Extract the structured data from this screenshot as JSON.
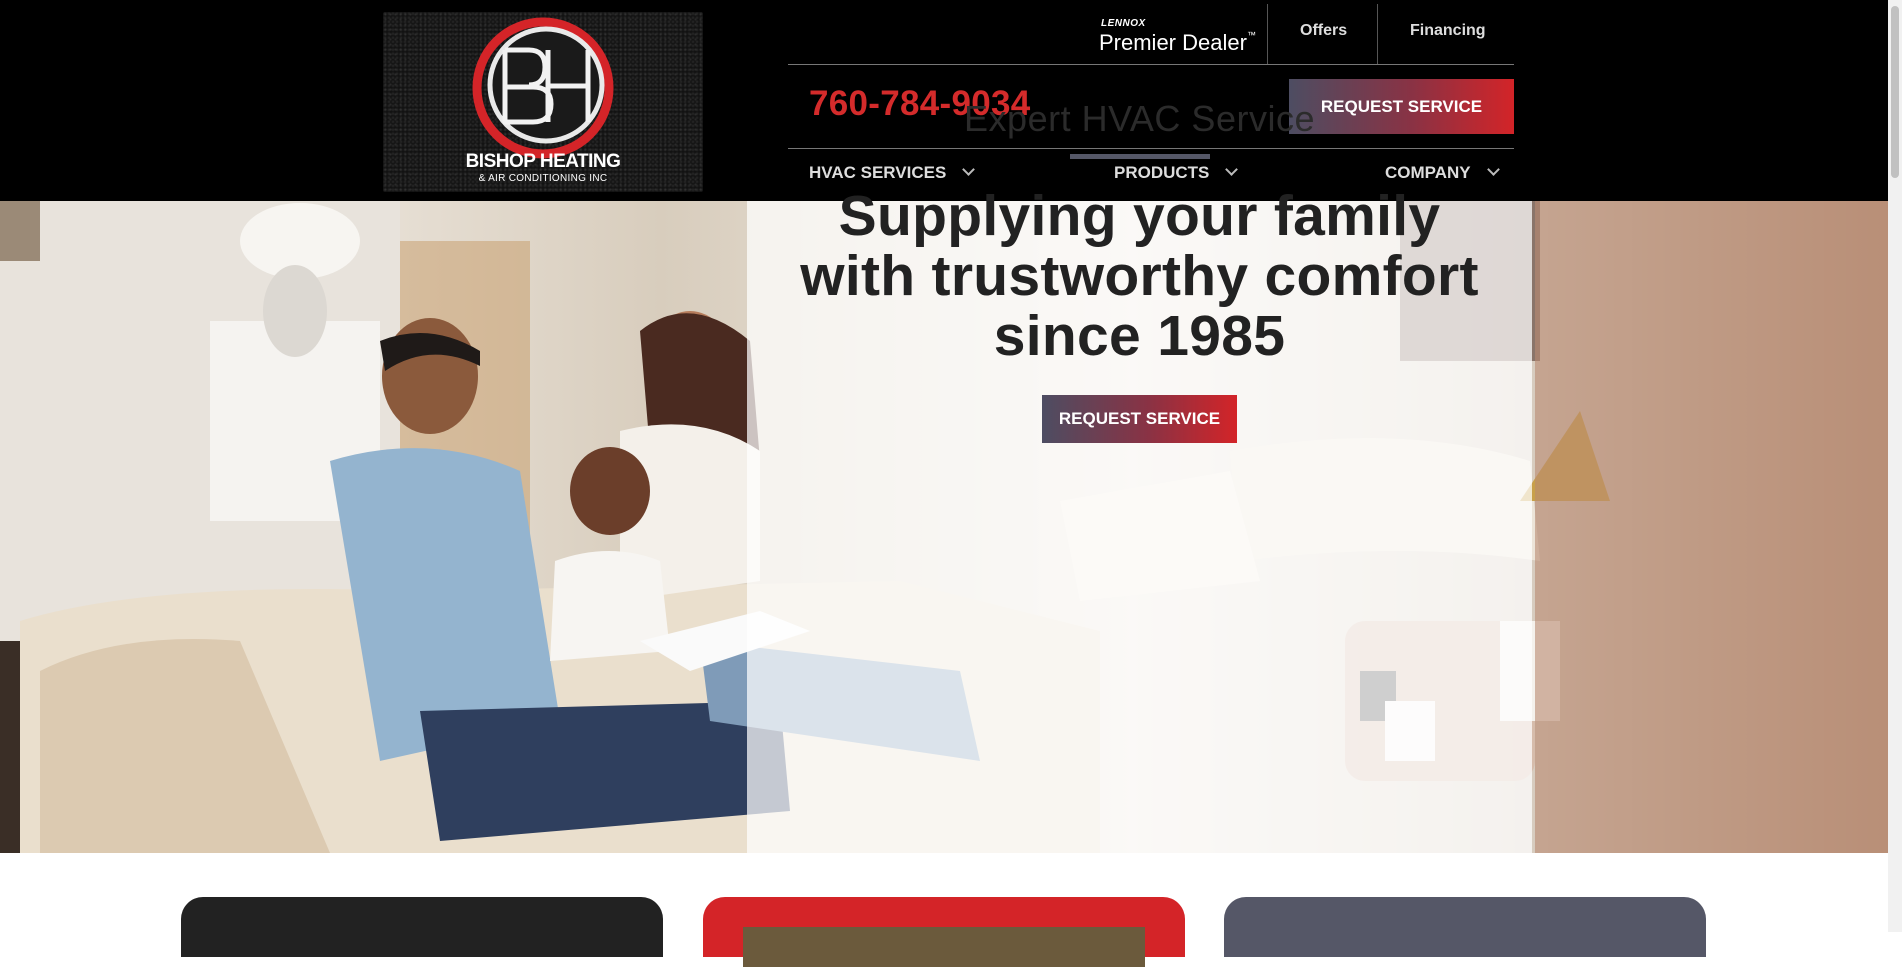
{
  "header": {
    "logo": {
      "name": "BISHOP HEATING",
      "sub": "& AIR CONDITIONING INC"
    },
    "dealer": {
      "brand": "LENNOX",
      "label": "Premier Dealer",
      "tm": "™"
    },
    "links": {
      "offers": "Offers",
      "financing": "Financing"
    },
    "phone": "760-784-9034",
    "cta": "REQUEST SERVICE",
    "nav": {
      "hvac": "HVAC SERVICES",
      "products": "PRODUCTS",
      "company": "COMPANY"
    }
  },
  "hero": {
    "subtitle": "Expert HVAC Service",
    "title_line1": "Supplying your family",
    "title_line2": "with trustworthy comfort",
    "title_line3": "since 1985",
    "cta": "REQUEST SERVICE"
  },
  "colors": {
    "accent_red": "#d42b2b",
    "slate": "#555767",
    "header_bg": "#000000"
  }
}
